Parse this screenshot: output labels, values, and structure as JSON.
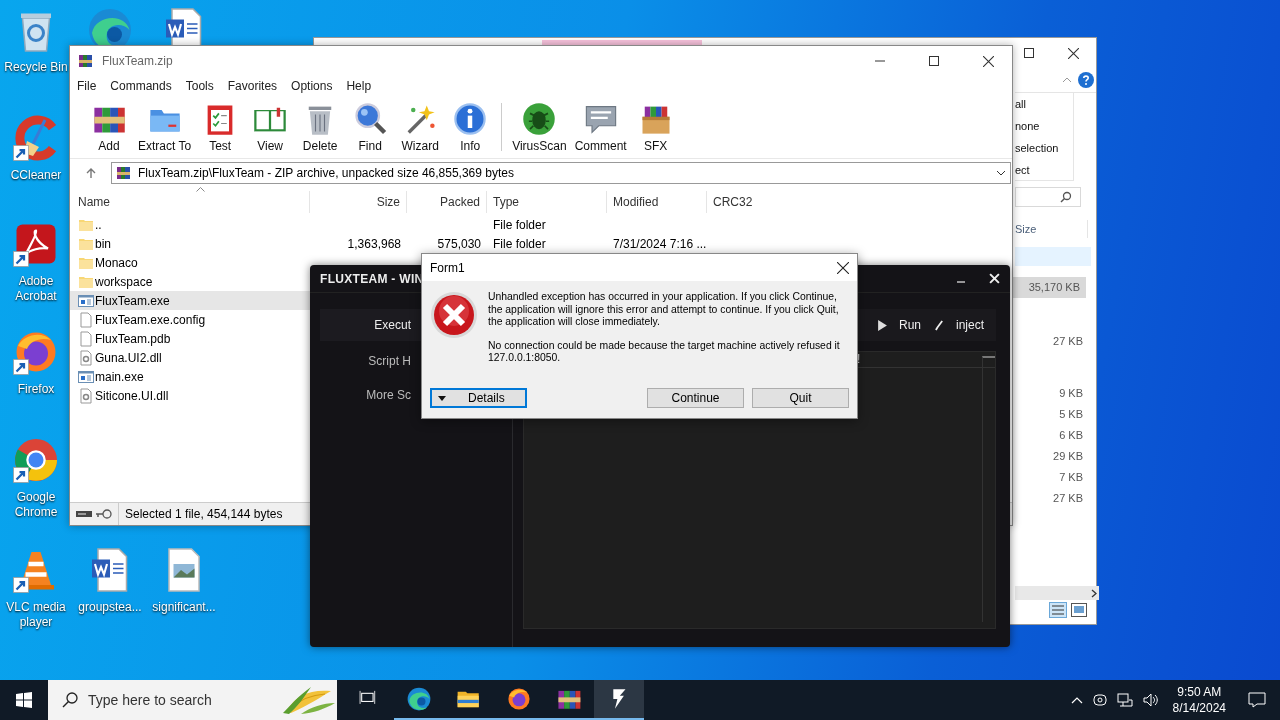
{
  "desktop_icons": [
    {
      "kind": "recycle",
      "label": "Recycle Bin"
    },
    {
      "kind": "edge"
    },
    {
      "kind": "word"
    },
    {
      "kind": "ccleaner",
      "label": "CCleaner",
      "shortcut": true
    },
    {
      "kind": "acrobat",
      "label": "Adobe Acrobat",
      "shortcut": true
    },
    {
      "kind": "firefox",
      "label": "Firefox",
      "shortcut": true
    },
    {
      "kind": "chrome",
      "label": "Google Chrome",
      "shortcut": true
    },
    {
      "kind": "vlc",
      "label": "VLC media player",
      "shortcut": true
    },
    {
      "kind": "word",
      "label": "groupstea..."
    },
    {
      "kind": "image",
      "label": "significant..."
    }
  ],
  "explorer_window": {
    "ribbon_labels": [
      "all",
      "none",
      "selection",
      "ect"
    ],
    "size_header": "Size",
    "size_rows": [
      {
        "text": "35,170 KB",
        "selected": true
      },
      {
        "text": "27 KB",
        "selected": false
      },
      {
        "text": "9 KB",
        "selected": false
      },
      {
        "text": "5 KB",
        "selected": false
      },
      {
        "text": "6 KB",
        "selected": false
      },
      {
        "text": "29 KB",
        "selected": false
      },
      {
        "text": "7 KB",
        "selected": false
      },
      {
        "text": "27 KB",
        "selected": false
      }
    ]
  },
  "winrar": {
    "title": "FluxTeam.zip",
    "menu": [
      "File",
      "Commands",
      "Tools",
      "Favorites",
      "Options",
      "Help"
    ],
    "toolbar": [
      {
        "kind": "add",
        "label": "Add"
      },
      {
        "kind": "extract",
        "label": "Extract To"
      },
      {
        "kind": "test",
        "label": "Test"
      },
      {
        "kind": "view",
        "label": "View"
      },
      {
        "kind": "delete",
        "label": "Delete"
      },
      {
        "kind": "find",
        "label": "Find"
      },
      {
        "kind": "wizard",
        "label": "Wizard"
      },
      {
        "kind": "info",
        "label": "Info"
      },
      {
        "kind": "virusscan",
        "label": "VirusScan"
      },
      {
        "kind": "comment",
        "label": "Comment"
      },
      {
        "kind": "sfx",
        "label": "SFX"
      }
    ],
    "path": "FluxTeam.zip\\FluxTeam - ZIP archive, unpacked size 46,855,369 bytes",
    "columns": [
      "Name",
      "Size",
      "Packed",
      "Type",
      "Modified",
      "CRC32"
    ],
    "rows": [
      {
        "kind": "folder",
        "name": "..",
        "type": "File folder",
        "selected": false
      },
      {
        "kind": "folder",
        "name": "bin",
        "size": "1,363,968",
        "packed": "575,030",
        "type": "File folder",
        "modified": "7/31/2024 7:16 ...",
        "selected": false
      },
      {
        "kind": "folder",
        "name": "Monaco",
        "selected": false
      },
      {
        "kind": "folder",
        "name": "workspace",
        "selected": false
      },
      {
        "kind": "exe",
        "name": "FluxTeam.exe",
        "selected": true
      },
      {
        "kind": "file",
        "name": "FluxTeam.exe.config",
        "selected": false
      },
      {
        "kind": "file",
        "name": "FluxTeam.pdb",
        "selected": false
      },
      {
        "kind": "dll",
        "name": "Guna.UI2.dll",
        "selected": false
      },
      {
        "kind": "exe",
        "name": "main.exe",
        "selected": false
      },
      {
        "kind": "dll",
        "name": "Siticone.UI.dll",
        "selected": false
      }
    ],
    "status": "Selected 1 file, 454,144 bytes"
  },
  "flux": {
    "title": "FLUXTEAM - WIN",
    "nav": [
      {
        "label": "Execut",
        "selected": true
      },
      {
        "label": "Script H",
        "selected": false
      },
      {
        "label": "More Sc",
        "selected": false
      }
    ],
    "actions": [
      {
        "kind": "run",
        "label": "Run"
      },
      {
        "kind": "inject",
        "label": "inject"
      }
    ],
    "tab_mark": "!"
  },
  "dialog": {
    "title": "Form1",
    "paragraphs": [
      "Unhandled exception has occurred in your application. If you click Continue, the application will ignore this error and attempt to continue. If you click Quit, the application will close immediately.",
      "No connection could be made because the target machine actively refused it 127.0.0.1:8050."
    ],
    "buttons": [
      {
        "kind": "details",
        "label": "Details",
        "focused": true
      },
      {
        "kind": "plain",
        "label": "Continue",
        "focused": false
      },
      {
        "kind": "plain",
        "label": "Quit",
        "focused": false
      }
    ]
  },
  "taskbar": {
    "search_placeholder": "Type here to search",
    "apps": [
      {
        "kind": "taskview",
        "running": false,
        "active": false
      },
      {
        "kind": "edge",
        "running": true,
        "active": false
      },
      {
        "kind": "explorer",
        "running": true,
        "active": false
      },
      {
        "kind": "firefox",
        "running": true,
        "active": false
      },
      {
        "kind": "winrar",
        "running": true,
        "active": false
      },
      {
        "kind": "flux",
        "running": true,
        "active": true
      }
    ],
    "time": "9:50 AM",
    "date": "8/14/2024"
  }
}
